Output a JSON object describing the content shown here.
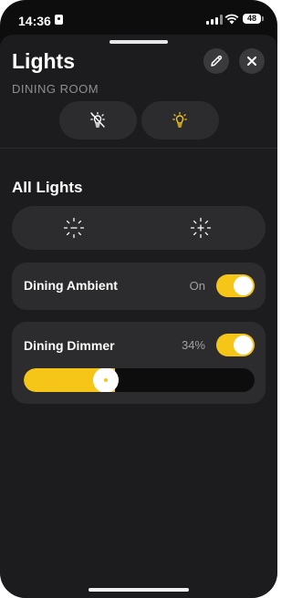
{
  "status_bar": {
    "time": "14:36",
    "battery": "48"
  },
  "header": {
    "title": "Lights",
    "subtitle": "DINING ROOM"
  },
  "icons": {
    "edit": "pencil-icon",
    "close": "close-icon",
    "all_off": "light-off-icon",
    "all_on": "lightbulb-icon",
    "dim_down": "brightness-down-icon",
    "dim_up": "brightness-up-icon"
  },
  "section": {
    "title": "All Lights"
  },
  "devices": [
    {
      "name": "Dining Ambient",
      "status": "On",
      "on": true
    },
    {
      "name": "Dining Dimmer",
      "status": "34%",
      "on": true,
      "brightness": 34
    }
  ],
  "colors": {
    "accent": "#f5c518",
    "background": "#0d0d0d",
    "sheet": "#1c1c1e",
    "card": "#2c2c2e"
  }
}
